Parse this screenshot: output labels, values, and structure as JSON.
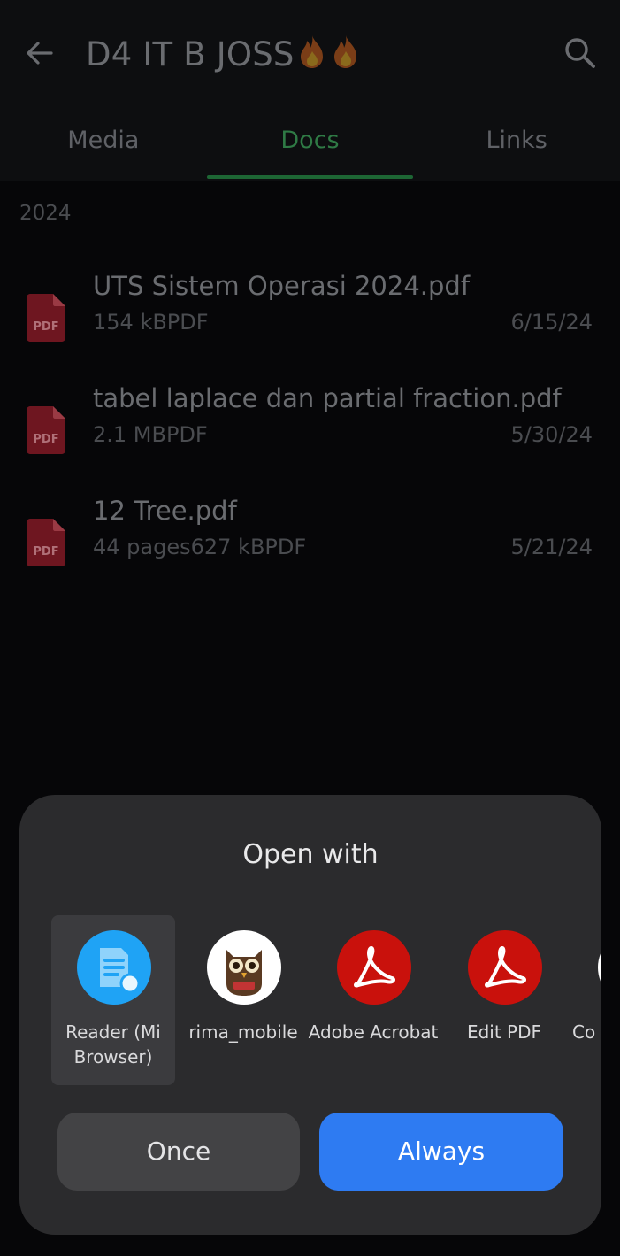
{
  "header": {
    "title": "D4 IT B JOSS",
    "title_emoji": "🔥🔥",
    "back_icon": "arrow-left-icon",
    "search_icon": "search-icon"
  },
  "tabs": [
    {
      "label": "Media",
      "active": false
    },
    {
      "label": "Docs",
      "active": true
    },
    {
      "label": "Links",
      "active": false
    }
  ],
  "section_label": "2024",
  "documents": [
    {
      "name": "UTS Sistem Operasi 2024.pdf",
      "meta": "154 kBPDF",
      "date": "6/15/24",
      "icon_label": "PDF"
    },
    {
      "name": "tabel laplace dan partial fraction.pdf",
      "meta": "2.1 MBPDF",
      "date": "5/30/24",
      "icon_label": "PDF"
    },
    {
      "name": "12 Tree.pdf",
      "meta": "44 pages627 kBPDF",
      "date": "5/21/24",
      "icon_label": "PDF"
    }
  ],
  "dialog": {
    "title": "Open with",
    "apps": [
      {
        "label": "Reader (Mi Browser)",
        "icon": "reader-icon",
        "selected": true
      },
      {
        "label": "rima_mobile",
        "icon": "owl-icon",
        "selected": false
      },
      {
        "label": "Adobe Acrobat",
        "icon": "acrobat-icon",
        "selected": false
      },
      {
        "label": "Edit PDF",
        "icon": "acrobat-icon",
        "selected": false
      },
      {
        "label": "Co",
        "icon": "app-icon",
        "selected": false
      }
    ],
    "once_label": "Once",
    "always_label": "Always"
  },
  "colors": {
    "accent": "#2e7bf2",
    "tab_active": "#2f7a45",
    "pdf_red": "#7a1a22",
    "sheet_bg": "#2b2b2d"
  }
}
